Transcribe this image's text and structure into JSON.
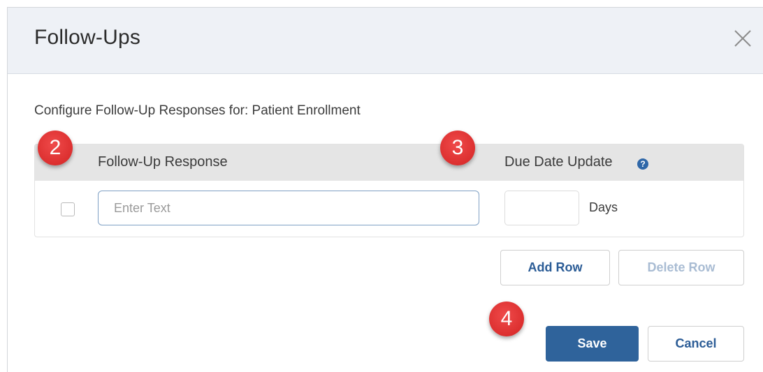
{
  "dialog": {
    "title": "Follow-Ups",
    "subtitle": "Configure Follow-Up Responses for: Patient Enrollment"
  },
  "grid": {
    "columns": {
      "response": "Follow-Up Response",
      "due_date": "Due Date Update"
    },
    "help_icon": "question-mark-icon",
    "rows": [
      {
        "checked": false,
        "response_placeholder": "Enter Text",
        "response_value": "",
        "days_value": "",
        "days_label": "Days"
      }
    ]
  },
  "actions": {
    "add_row": "Add Row",
    "delete_row": "Delete Row",
    "save": "Save",
    "cancel": "Cancel"
  },
  "callouts": {
    "marker_2": "2",
    "marker_3": "3",
    "marker_4": "4"
  },
  "colors": {
    "header_bg": "#eef1f6",
    "grid_header_bg": "#e5e5e5",
    "primary_button": "#2f639b",
    "link_text": "#2b5c96",
    "disabled_text": "#a9bcd3",
    "marker_red": "#dc2f2f"
  }
}
